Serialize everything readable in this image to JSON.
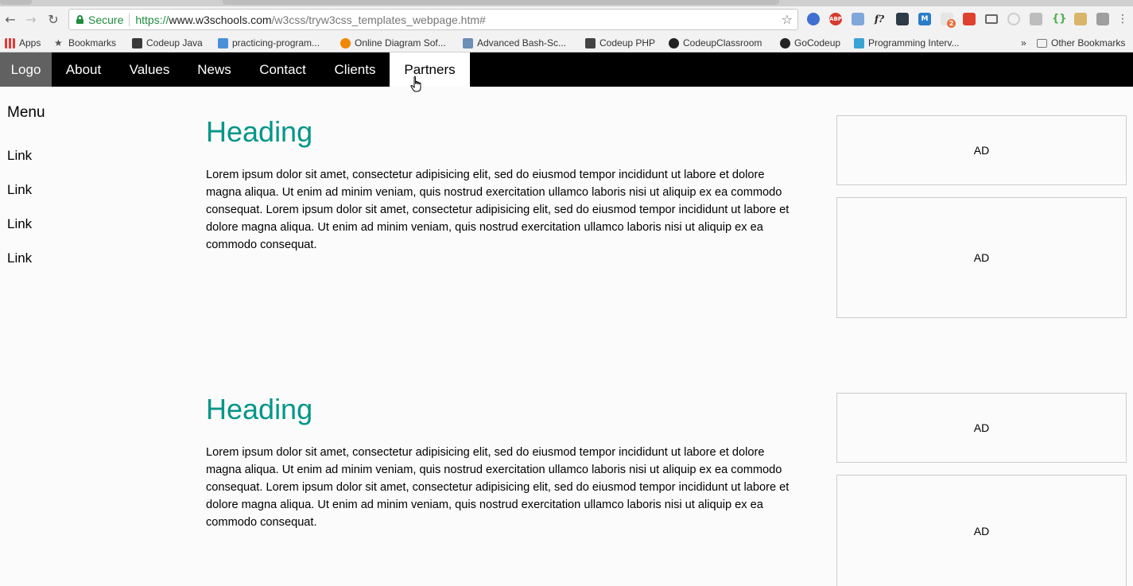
{
  "browser": {
    "secure_label": "Secure",
    "url_scheme": "https://",
    "url_host": "www.w3schools.com",
    "url_path": "/w3css/tryw3css_templates_webpage.htm#",
    "bookmarks": [
      "Apps",
      "Bookmarks",
      "Codeup Java",
      "practicing-program...",
      "Online Diagram Sof...",
      "Advanced Bash-Sc...",
      "Codeup PHP",
      "CodeupClassroom",
      "GoCodeup",
      "Programming Interv..."
    ],
    "other_bookmarks": "Other Bookmarks",
    "overflow": "»",
    "extensions": [
      "ABP",
      "f?",
      "M",
      "2"
    ]
  },
  "nav": {
    "logo": "Logo",
    "items": [
      "About",
      "Values",
      "News",
      "Contact",
      "Clients",
      "Partners"
    ]
  },
  "sidebar": {
    "title": "Menu",
    "links": [
      "Link",
      "Link",
      "Link",
      "Link"
    ]
  },
  "sections": [
    {
      "heading": "Heading",
      "lines": [
        "Lorem ipsum dolor sit amet, consectetur adipisicing elit, sed do eiusmod tempor incididunt ut labore et dolore",
        "magna aliqua. Ut enim ad minim veniam, quis nostrud exercitation ullamco laboris nisi ut aliquip ex ea commodo",
        "consequat. Lorem ipsum dolor sit amet, consectetur adipisicing elit, sed do eiusmod tempor incididunt ut labore et",
        "dolore magna aliqua. Ut enim ad minim veniam, quis nostrud exercitation ullamco laboris nisi ut aliquip ex ea",
        "commodo consequat."
      ]
    },
    {
      "heading": "Heading",
      "lines": [
        "Lorem ipsum dolor sit amet, consectetur adipisicing elit, sed do eiusmod tempor incididunt ut labore et dolore",
        "magna aliqua. Ut enim ad minim veniam, quis nostrud exercitation ullamco laboris nisi ut aliquip ex ea commodo",
        "consequat. Lorem ipsum dolor sit amet, consectetur adipisicing elit, sed do eiusmod tempor incididunt ut labore et",
        "dolore magna aliqua. Ut enim ad minim veniam, quis nostrud exercitation ullamco laboris nisi ut aliquip ex ea",
        "commodo consequat."
      ]
    }
  ],
  "ads": [
    "AD",
    "AD",
    "AD",
    "AD"
  ],
  "colors": {
    "heading": "#009688",
    "navbar": "#000000",
    "logo_bg": "#616161",
    "active_tab_bg": "#ffffff",
    "secure_green": "#1e8e3e"
  }
}
